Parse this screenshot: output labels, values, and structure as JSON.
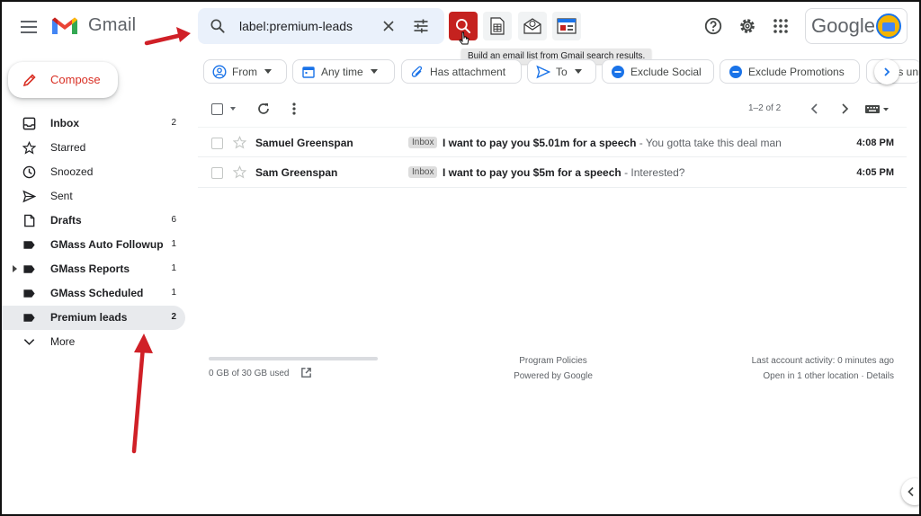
{
  "app": {
    "name": "Gmail",
    "account_brand": "Google"
  },
  "search": {
    "value": "label:premium-leads"
  },
  "tooltip": "Build an email list from Gmail search results.",
  "compose_label": "Compose",
  "nav": [
    {
      "label": "Inbox",
      "count": "2",
      "bold": true,
      "icon": "inbox-icon"
    },
    {
      "label": "Starred",
      "count": "",
      "bold": false,
      "icon": "star-icon"
    },
    {
      "label": "Snoozed",
      "count": "",
      "bold": false,
      "icon": "clock-icon"
    },
    {
      "label": "Sent",
      "count": "",
      "bold": false,
      "icon": "send-icon"
    },
    {
      "label": "Drafts",
      "count": "6",
      "bold": true,
      "icon": "draft-icon"
    },
    {
      "label": "GMass Auto Followup",
      "count": "1",
      "bold": true,
      "icon": "label-icon"
    },
    {
      "label": "GMass Reports",
      "count": "1",
      "bold": true,
      "icon": "label-icon"
    },
    {
      "label": "GMass Scheduled",
      "count": "1",
      "bold": true,
      "icon": "label-icon"
    },
    {
      "label": "Premium leads",
      "count": "2",
      "bold": true,
      "icon": "label-icon"
    },
    {
      "label": "More",
      "count": "",
      "bold": false,
      "icon": "chevron-down-icon"
    }
  ],
  "filters": [
    {
      "label": "From",
      "icon": "person-icon",
      "dropdown": true
    },
    {
      "label": "Any time",
      "icon": "calendar-icon",
      "dropdown": true
    },
    {
      "label": "Has attachment",
      "icon": "paperclip-icon",
      "dropdown": false
    },
    {
      "label": "To",
      "icon": "send-icon",
      "dropdown": true
    },
    {
      "label": "Exclude Social",
      "icon": "minus-circle-icon",
      "dropdown": false
    },
    {
      "label": "Exclude Promotions",
      "icon": "minus-circle-icon",
      "dropdown": false
    },
    {
      "label": "Is unread",
      "icon": "unread-icon",
      "dropdown": false
    }
  ],
  "pager_text": "1–2 of 2",
  "emails": [
    {
      "sender": "Samuel Greenspan",
      "label": "Inbox",
      "subject": "I want to pay you $5.01m for a speech",
      "snippet": " - You gotta take this deal man",
      "time": "4:08 PM"
    },
    {
      "sender": "Sam Greenspan",
      "label": "Inbox",
      "subject": "I want to pay you $5m for a speech",
      "snippet": " - Interested?",
      "time": "4:05 PM"
    }
  ],
  "footer": {
    "storage": "0 GB of 30 GB used",
    "storage_fraction": 0.0,
    "policies": "Program Policies",
    "powered": "Powered by Google",
    "activity": "Last account activity: 0 minutes ago",
    "location": "Open in 1 other location · Details"
  },
  "colors": {
    "accent_red": "#c5221f",
    "compose_red": "#d93025",
    "search_bg": "#eaf1fb",
    "active_nav_bg": "#e8eaed",
    "annotation_arrow": "#d02027"
  }
}
